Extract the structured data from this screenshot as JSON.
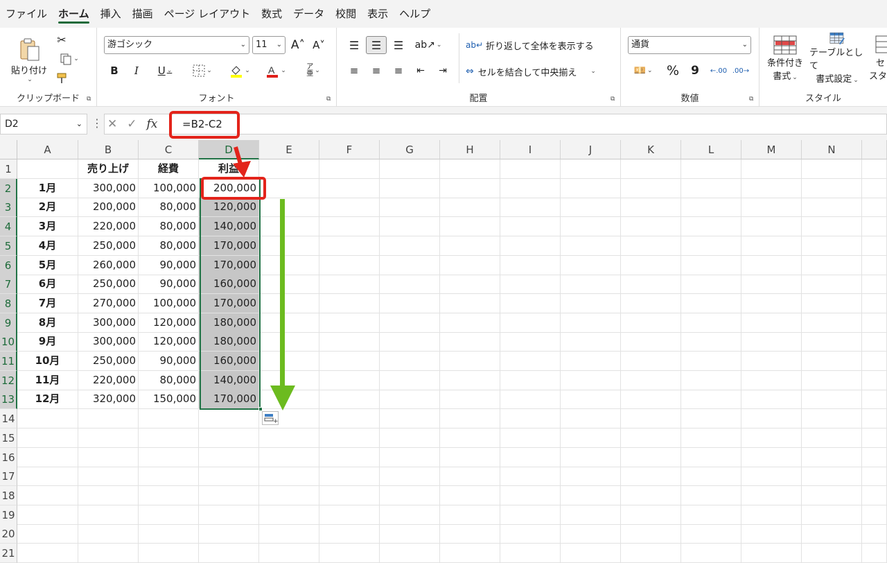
{
  "menu": {
    "tabs": [
      "ファイル",
      "ホーム",
      "挿入",
      "描画",
      "ページ レイアウト",
      "数式",
      "データ",
      "校閲",
      "表示",
      "ヘルプ"
    ],
    "active": "ホーム"
  },
  "ribbon": {
    "clipboard": {
      "paste_label": "貼り付け",
      "group_label": "クリップボード"
    },
    "font": {
      "font_name": "游ゴシック",
      "font_size": "11",
      "bold": "B",
      "italic": "I",
      "underline": "U",
      "group_label": "フォント"
    },
    "alignment": {
      "wrap_label": "折り返して全体を表示する",
      "merge_label": "セルを結合して中央揃え",
      "group_label": "配置"
    },
    "number": {
      "format": "通貨",
      "percent": "%",
      "comma": "9",
      "group_label": "数値"
    },
    "styles": {
      "conditional_label_1": "条件付き",
      "conditional_label_2": "書式",
      "table_label_1": "テーブルとして",
      "table_label_2": "書式設定",
      "cell_label_1": "セ",
      "cell_label_2": "スタ",
      "group_label": "スタイル"
    }
  },
  "formula_bar": {
    "name_box": "D2",
    "fx": "fx",
    "formula": "=B2-C2"
  },
  "sheet": {
    "columns": [
      "A",
      "B",
      "C",
      "D",
      "E",
      "F",
      "G",
      "H",
      "I",
      "J",
      "K",
      "L",
      "M",
      "N"
    ],
    "rows": [
      "1",
      "2",
      "3",
      "4",
      "5",
      "6",
      "7",
      "8",
      "9",
      "10",
      "11",
      "12",
      "13",
      "14",
      "15",
      "16",
      "17",
      "18",
      "19",
      "20",
      "21"
    ],
    "header": [
      "",
      "売り上げ",
      "経費",
      "利益"
    ],
    "data": [
      [
        "1月",
        "300,000",
        "100,000",
        "200,000"
      ],
      [
        "2月",
        "200,000",
        "80,000",
        "120,000"
      ],
      [
        "3月",
        "220,000",
        "80,000",
        "140,000"
      ],
      [
        "4月",
        "250,000",
        "80,000",
        "170,000"
      ],
      [
        "5月",
        "260,000",
        "90,000",
        "170,000"
      ],
      [
        "6月",
        "250,000",
        "90,000",
        "160,000"
      ],
      [
        "7月",
        "270,000",
        "100,000",
        "170,000"
      ],
      [
        "8月",
        "300,000",
        "120,000",
        "180,000"
      ],
      [
        "9月",
        "300,000",
        "120,000",
        "180,000"
      ],
      [
        "10月",
        "250,000",
        "90,000",
        "160,000"
      ],
      [
        "11月",
        "220,000",
        "80,000",
        "140,000"
      ],
      [
        "12月",
        "320,000",
        "150,000",
        "170,000"
      ]
    ],
    "selected_cell": "D2",
    "selected_range": "D2:D13"
  },
  "colors": {
    "accent": "#217346",
    "callout": "#e3241b",
    "arrow": "#6cbb1f"
  }
}
